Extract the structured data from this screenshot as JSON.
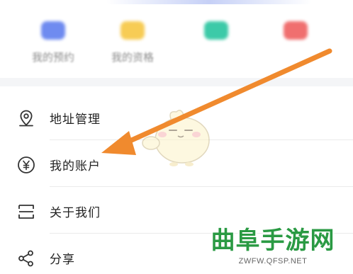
{
  "shortcuts": [
    {
      "label": "我的预约",
      "icon": "calendar-icon",
      "color": "#6f8bf0"
    },
    {
      "label": "我的资格",
      "icon": "badge-icon",
      "color": "#f7cc55"
    },
    {
      "label": "",
      "icon": "chat-icon",
      "color": "#3ccaa8"
    },
    {
      "label": "",
      "icon": "gift-icon",
      "color": "#f06f6f"
    }
  ],
  "menu": {
    "items": [
      {
        "label": "地址管理",
        "icon": "location-pin-icon"
      },
      {
        "label": "我的账户",
        "icon": "yen-circle-icon"
      },
      {
        "label": "关于我们",
        "icon": "info-box-icon"
      },
      {
        "label": "分享",
        "icon": "share-icon"
      }
    ]
  },
  "overlay": {
    "arrow_color": "#f08a2e",
    "watermark_title": "曲阜手游网",
    "watermark_url": "ZWFW.QFSP.NET",
    "watermark_color": "#2a9a43"
  }
}
